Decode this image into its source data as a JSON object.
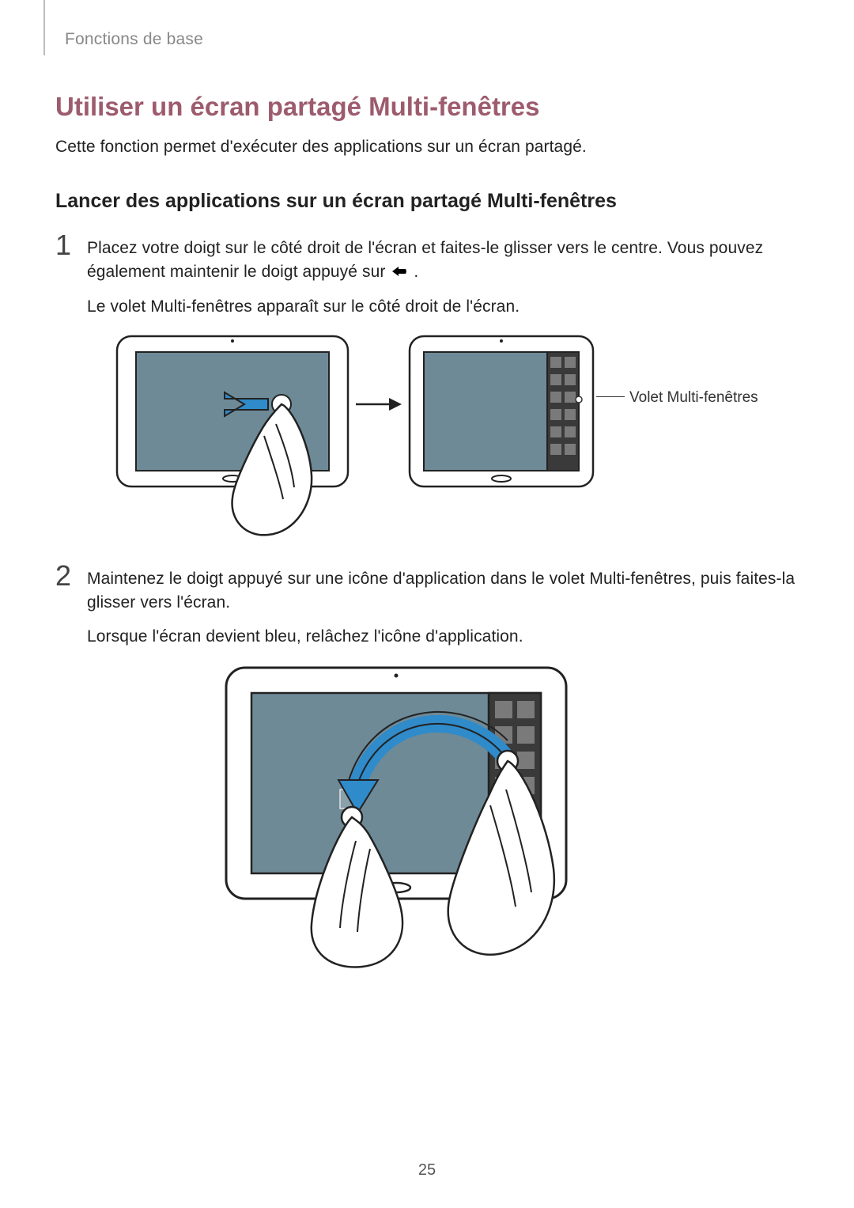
{
  "breadcrumb": "Fonctions de base",
  "section_title": "Utiliser un écran partagé Multi-fenêtres",
  "intro": "Cette fonction permet d'exécuter des applications sur un écran partagé.",
  "sub_title": "Lancer des applications sur un écran partagé Multi-fenêtres",
  "steps": {
    "s1": {
      "p1a": "Placez votre doigt sur le côté droit de l'écran et faites-le glisser vers le centre. Vous pouvez également maintenir le doigt appuyé sur ",
      "p1b": ".",
      "p2": "Le volet Multi-fenêtres apparaît sur le côté droit de l'écran."
    },
    "s2": {
      "p1": "Maintenez le doigt appuyé sur une icône d'application dans le volet Multi-fenêtres, puis faites-la glisser vers l'écran.",
      "p2": "Lorsque l'écran devient bleu, relâchez l'icône d'application."
    }
  },
  "callouts": {
    "tray_label": "Volet Multi-fenêtres"
  },
  "page_number": "25"
}
